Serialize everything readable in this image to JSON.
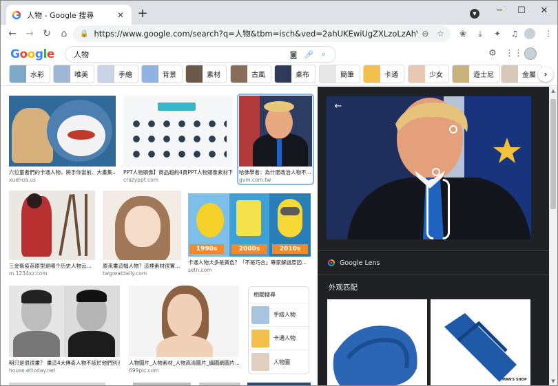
{
  "browser": {
    "tab_title": "人物 - Google 搜尋",
    "tab_close": "✕",
    "new_tab": "+",
    "url": "https://www.google.com/search?q=人物&tbm=isch&ved=2ahUKEwiUgZXLzoLzAhVphMYK...",
    "window_controls": {
      "minimize": "─",
      "maximize": "☐",
      "close": "✕"
    }
  },
  "google": {
    "logo": "Google",
    "query": "人物",
    "colors": {
      "blue": "#4285f4",
      "red": "#ea4335",
      "yellow": "#fbbc05",
      "green": "#34a853"
    }
  },
  "chips": [
    {
      "label": "水彩",
      "color": "#7fa9c9"
    },
    {
      "label": "唯美",
      "color": "#9fb6d6"
    },
    {
      "label": "手繪",
      "color": "#c9d4e6"
    },
    {
      "label": "背景",
      "color": "#8fb3e0"
    },
    {
      "label": "素材",
      "color": "#6b5a4a"
    },
    {
      "label": "古風",
      "color": "#8a6d58"
    },
    {
      "label": "桌布",
      "color": "#2e3a5a"
    },
    {
      "label": "簡筆",
      "color": "#e8e8e8"
    },
    {
      "label": "卡通",
      "color": "#f2c04a"
    },
    {
      "label": "少女",
      "color": "#e8c8b0"
    },
    {
      "label": "遊士尼",
      "color": "#c9b27a"
    },
    {
      "label": "金屬",
      "color": "#d8c8b8"
    }
  ],
  "results": [
    {
      "caption": "六位童者們的卡通人物，將手你當前、大畫集...",
      "source": "xuehua.us"
    },
    {
      "caption": "PPT人物頭像】商品超約4頁PPT人物頭像素材下...",
      "source": "crazyppt.com"
    },
    {
      "caption": "哈佛學者：為什麼政治人物不...",
      "source": "gvm.com.tw"
    },
    {
      "caption": "三金衛疫苗原型是哪个历史人物云...",
      "source": "m.1234xz.com"
    },
    {
      "caption": "原來畫這幅人物？這裡素材很實...",
      "source": "twgreatdaily.com"
    },
    {
      "caption": "卡通人物大多是黃色？「不是巧合」專家解謎原因...",
      "source": "setn.com"
    },
    {
      "caption": "明只是很很畫？ 畫這4大傳奇人物不該於他們別沒...",
      "source": "house.ettoday.net"
    },
    {
      "caption": "人物圖片_人物素材_人物高清圖片_攝圖網圖片...",
      "source": "699pic.com"
    }
  ],
  "pokemon_years": [
    "1990s",
    "2000s",
    "2010s"
  ],
  "related": {
    "heading": "相關搜尋",
    "items": [
      {
        "label": "手繪人物"
      },
      {
        "label": "卡通人物"
      },
      {
        "label": "人物圖"
      }
    ]
  },
  "lens": {
    "brand": "Google Lens",
    "section_title": "外观匹配",
    "match_brand": "MAN'S SHOP"
  }
}
